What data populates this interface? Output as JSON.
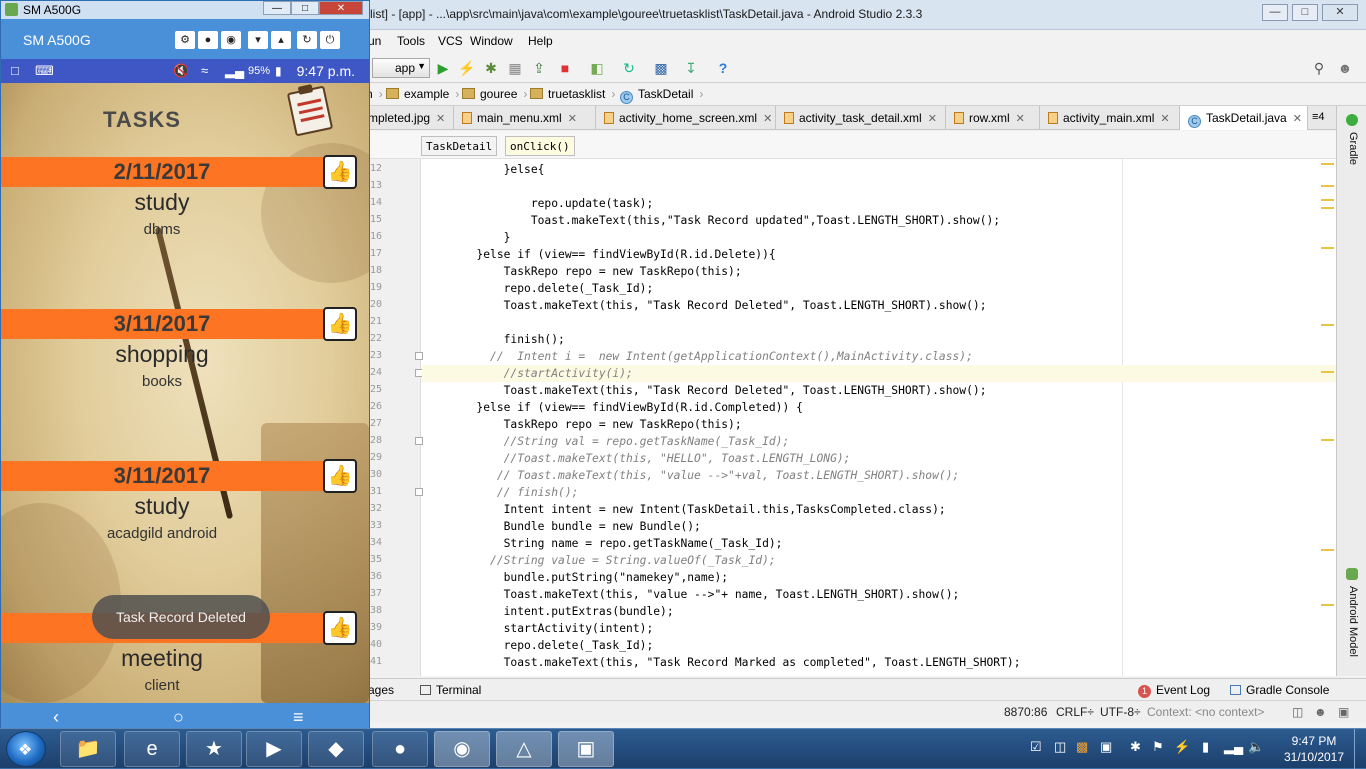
{
  "emulator": {
    "window_title": "SM A500G",
    "device_name": "SM A500G",
    "controls": [
      "gear-icon",
      "record-icon",
      "camera-icon",
      "volume-down-icon",
      "volume-up-icon",
      "rotate-icon",
      "power-icon"
    ],
    "status": {
      "battery": "95%",
      "time": "9:47 p.m."
    }
  },
  "phone_app": {
    "title": "TASKS",
    "tasks": [
      {
        "date": "2/11/2017",
        "name": "study",
        "desc": "dbms"
      },
      {
        "date": "3/11/2017",
        "name": "shopping",
        "desc": "books"
      },
      {
        "date": "3/11/2017",
        "name": "study",
        "desc": "acadgild android"
      },
      {
        "date": "",
        "name": "meeting",
        "desc": "client"
      }
    ],
    "toast": "Task Record Deleted"
  },
  "studio": {
    "title": "list] - [app] - ...\\app\\src\\main\\java\\com\\example\\gouree\\truetasklist\\TaskDetail.java - Android Studio 2.3.3",
    "menu": [
      "un",
      "Tools",
      "VCS",
      "Window",
      "Help"
    ],
    "toolbar": {
      "app_select": "app"
    },
    "breadcrumbs": [
      "n",
      "example",
      "gouree",
      "truetasklist",
      "TaskDetail"
    ],
    "file_tabs": [
      {
        "label": "mpleted.jpg",
        "active": false
      },
      {
        "label": "main_menu.xml",
        "active": false
      },
      {
        "label": "activity_home_screen.xml",
        "active": false
      },
      {
        "label": "activity_task_detail.xml",
        "active": false
      },
      {
        "label": "row.xml",
        "active": false
      },
      {
        "label": "activity_main.xml",
        "active": false
      },
      {
        "label": "TaskDetail.java",
        "active": true
      }
    ],
    "tab_overflow": "4",
    "structure": [
      "TaskDetail",
      "onClick()"
    ],
    "side_tabs": [
      "Gradle",
      "Android Model"
    ],
    "code": [
      {
        "n": "12",
        "t": "            }else{"
      },
      {
        "n": "13",
        "t": ""
      },
      {
        "n": "14",
        "t": "                repo.update(task);"
      },
      {
        "n": "15",
        "t": "                Toast.makeText(this,\"Task Record updated\",Toast.LENGTH_SHORT).show();"
      },
      {
        "n": "16",
        "t": "            }"
      },
      {
        "n": "17",
        "t": "        }else if (view== findViewById(R.id.Delete)){"
      },
      {
        "n": "18",
        "t": "            TaskRepo repo = new TaskRepo(this);"
      },
      {
        "n": "19",
        "t": "            repo.delete(_Task_Id);"
      },
      {
        "n": "20",
        "t": "            Toast.makeText(this, \"Task Record Deleted\", Toast.LENGTH_SHORT).show();"
      },
      {
        "n": "21",
        "t": ""
      },
      {
        "n": "22",
        "t": "            finish();"
      },
      {
        "n": "23",
        "t": "          //  Intent i =  new Intent(getApplicationContext(),MainActivity.class);"
      },
      {
        "n": "24",
        "t": "            //startActivity(i);"
      },
      {
        "n": "25",
        "t": "            Toast.makeText(this, \"Task Record Deleted\", Toast.LENGTH_SHORT).show();"
      },
      {
        "n": "26",
        "t": "        }else if (view== findViewById(R.id.Completed)) {"
      },
      {
        "n": "27",
        "t": "            TaskRepo repo = new TaskRepo(this);"
      },
      {
        "n": "28",
        "t": "            //String val = repo.getTaskName(_Task_Id);"
      },
      {
        "n": "29",
        "t": "            //Toast.makeText(this, \"HELLO\", Toast.LENGTH_LONG);"
      },
      {
        "n": "30",
        "t": "           // Toast.makeText(this, \"value -->\"+val, Toast.LENGTH_SHORT).show();"
      },
      {
        "n": "31",
        "t": "           // finish();"
      },
      {
        "n": "32",
        "t": "            Intent intent = new Intent(TaskDetail.this,TasksCompleted.class);"
      },
      {
        "n": "33",
        "t": "            Bundle bundle = new Bundle();"
      },
      {
        "n": "34",
        "t": "            String name = repo.getTaskName(_Task_Id);"
      },
      {
        "n": "35",
        "t": "          //String value = String.valueOf(_Task_Id);"
      },
      {
        "n": "36",
        "t": "            bundle.putString(\"namekey\",name);"
      },
      {
        "n": "37",
        "t": "            Toast.makeText(this, \"value -->\"+ name, Toast.LENGTH_SHORT).show();"
      },
      {
        "n": "38",
        "t": "            intent.putExtras(bundle);"
      },
      {
        "n": "39",
        "t": "            startActivity(intent);"
      },
      {
        "n": "40",
        "t": "            repo.delete(_Task_Id);"
      },
      {
        "n": "41",
        "t": "            Toast.makeText(this, \"Task Record Marked as completed\", Toast.LENGTH_SHORT);"
      }
    ],
    "bottom_tabs": [
      "ages",
      "Terminal",
      "Event Log",
      "Gradle Console"
    ],
    "event_log_count": "1",
    "status_bar": {
      "position": "8870:86",
      "line_sep": "CRLF÷",
      "encoding": "UTF-8÷",
      "context": "Context: <no context>"
    }
  },
  "taskbar": {
    "apps": [
      "folder-icon",
      "ie-icon",
      "star-icon",
      "media-icon",
      "paint-icon",
      "firefox-icon",
      "chrome-icon",
      "android-studio-icon",
      "emulator-icon"
    ],
    "clock_time": "9:47 PM",
    "clock_date": "31/10/2017"
  },
  "colors": {
    "accent_orange": "#fd7522",
    "emulator_blue": "#4a90d9",
    "status_blue": "#3e57c5"
  }
}
